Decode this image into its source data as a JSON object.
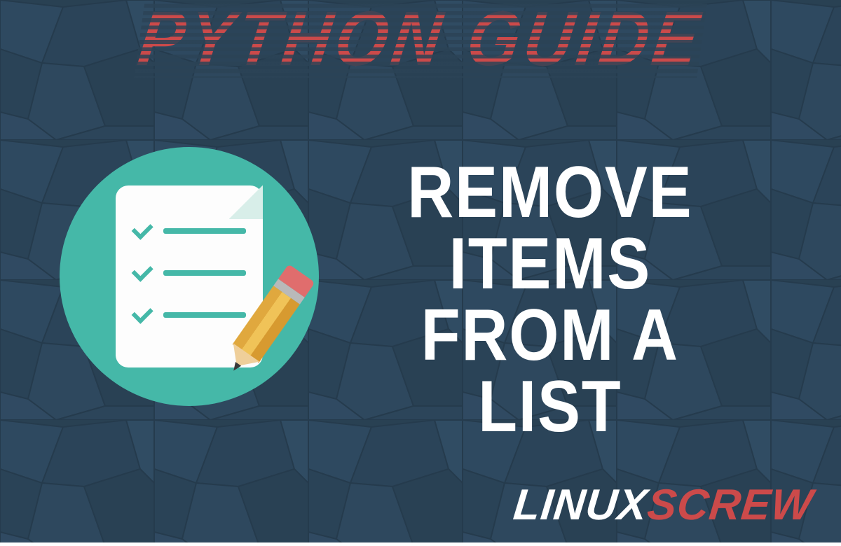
{
  "topline": "PYTHON GUIDE",
  "headline_line1": "REMOVE ITEMS",
  "headline_line2": "FROM A LIST",
  "logo_part1": "LINUX",
  "logo_part2": "SCREW",
  "colors": {
    "background": "#2b4356",
    "accent_red": "#cc4a4a",
    "badge_teal": "#45b8a8",
    "text_white": "#ffffff"
  },
  "icon": "checklist-with-pencil-icon"
}
